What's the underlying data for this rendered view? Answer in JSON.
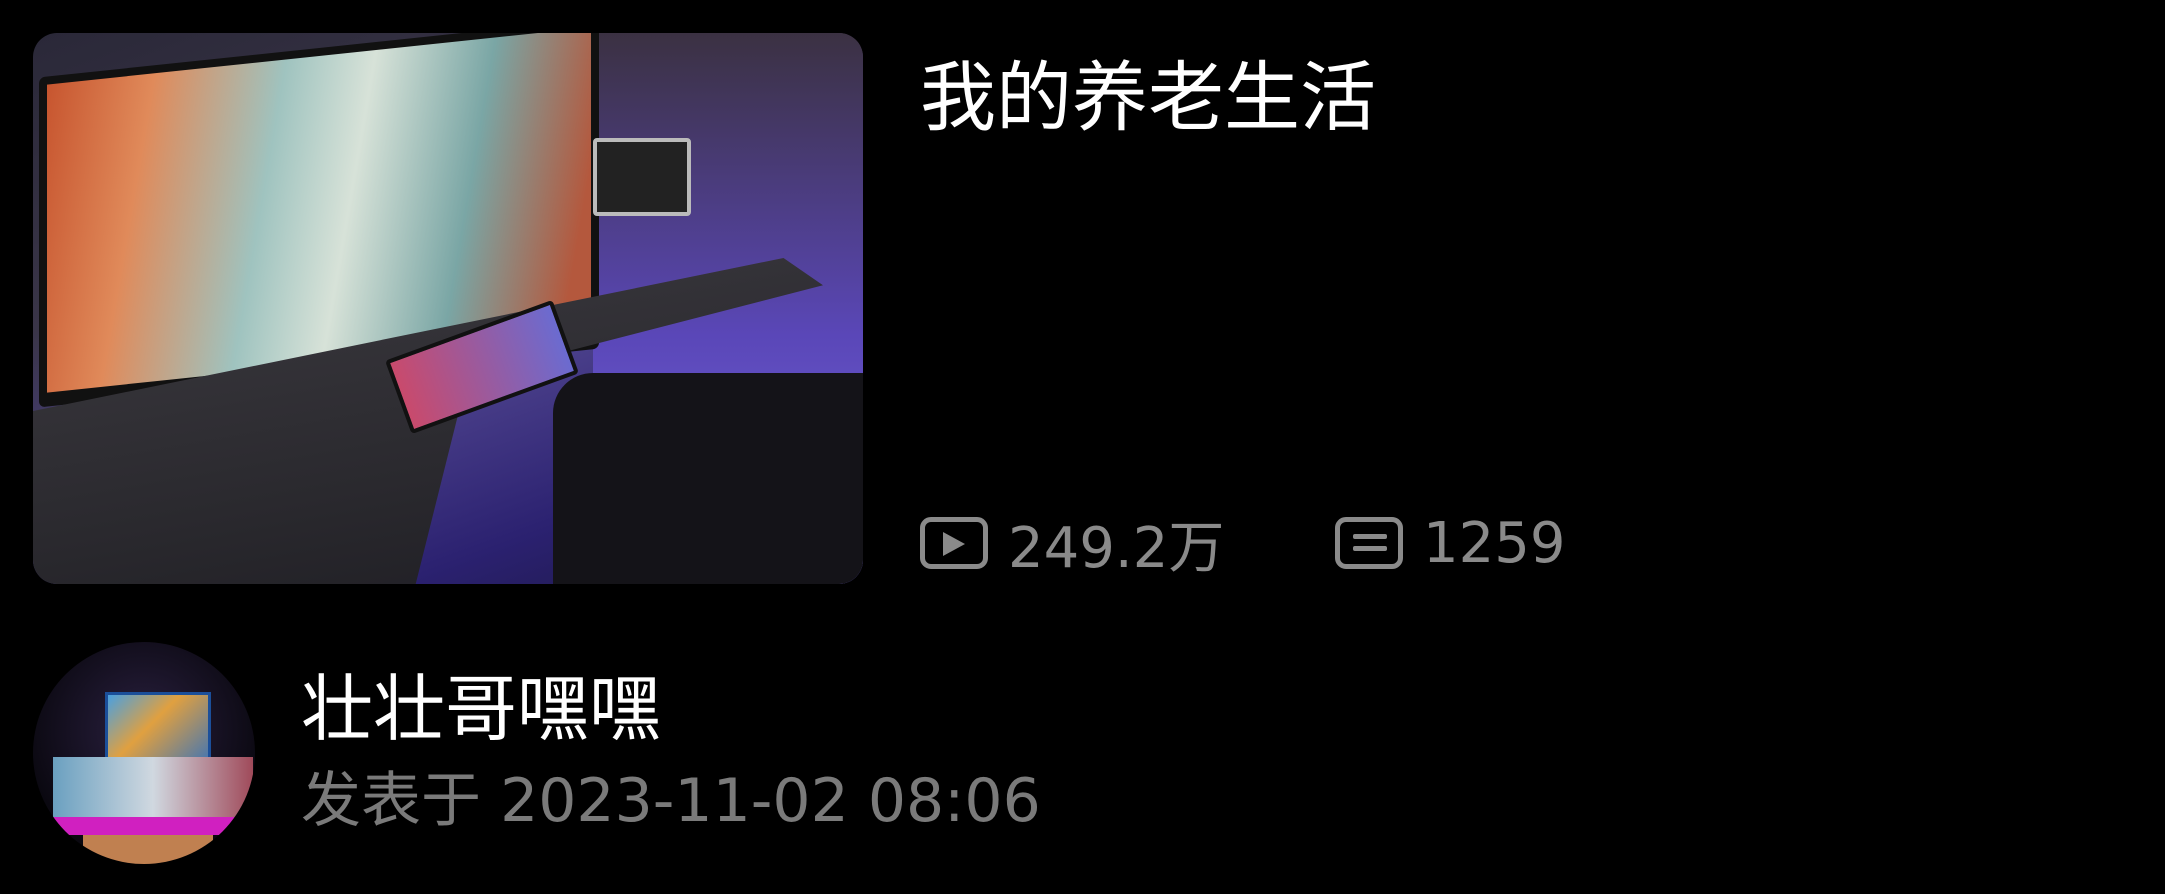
{
  "video": {
    "title": "我的养老生活",
    "play_icon": "play-icon",
    "views": "249.2万",
    "comment_icon": "comment-icon",
    "comments": "1259"
  },
  "author": {
    "name": "壮壮哥嘿嘿",
    "published": "发表于 2023-11-02 08:06"
  }
}
